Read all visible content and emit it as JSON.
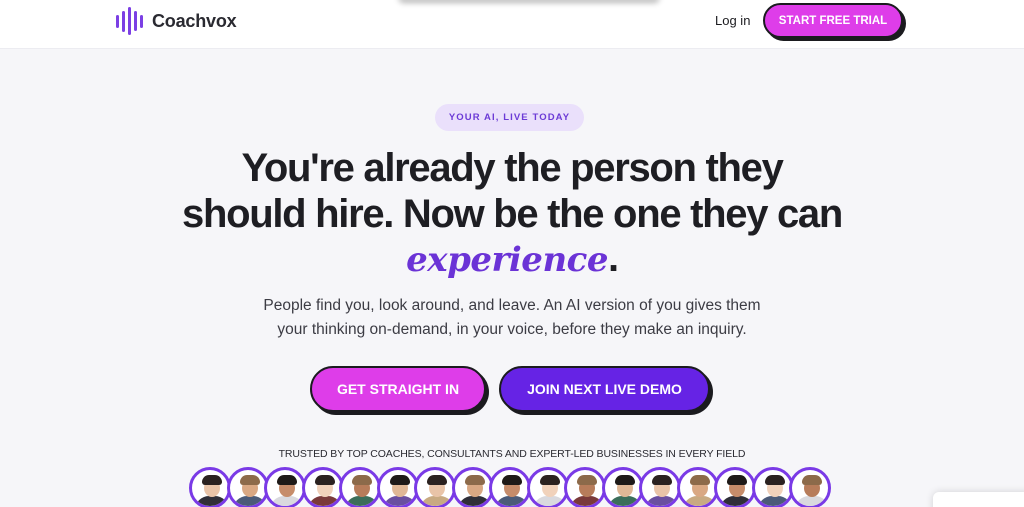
{
  "brand": {
    "name": "Coachvox",
    "icon": "waveform-logo-icon",
    "bar_heights": [
      0.45,
      0.75,
      1.0,
      0.7,
      0.45
    ]
  },
  "header": {
    "login_label": "Log in",
    "cta_label": "START FREE TRIAL"
  },
  "hero": {
    "badge": "YOUR AI, LIVE TODAY",
    "headline_line1": "You're already the person they",
    "headline_line2": "should hire. Now be the one they can",
    "headline_accent": "experience",
    "headline_end": ".",
    "subtext_line1": "People find you, look around, and leave. An AI version of you gives them",
    "subtext_line2": "your thinking on-demand, in your voice, before they make an inquiry.",
    "primary_cta": "GET STRAIGHT IN",
    "secondary_cta": "JOIN NEXT LIVE DEMO"
  },
  "trust": {
    "label": "TRUSTED BY TOP COACHES, CONSULTANTS AND EXPERT-LED BUSINESSES IN EVERY FIELD",
    "avatar_count": 17
  },
  "colors": {
    "brand_purple": "#6b33d6",
    "cta_pink": "#de3de9",
    "cta_violet": "#6623e5",
    "avatar_ring": "#7a3ae6"
  }
}
